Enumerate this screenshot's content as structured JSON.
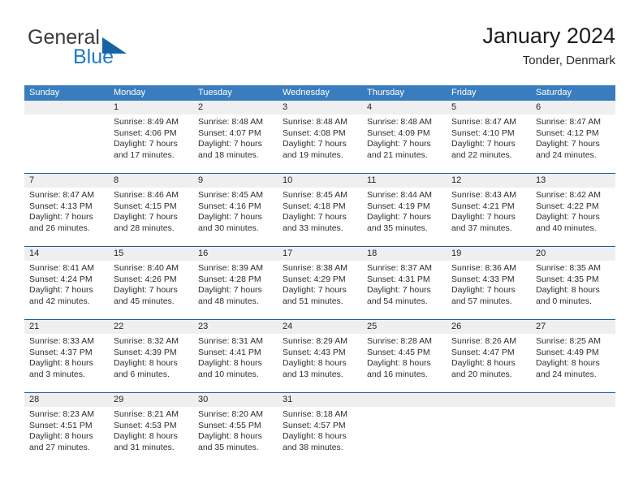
{
  "brand": {
    "word1": "General",
    "word2": "Blue",
    "triangle_color": "#1464a5"
  },
  "header": {
    "title": "January 2024",
    "subtitle": "Tonder, Denmark"
  },
  "theme": {
    "header_blue": "#3a7dbf",
    "separator_blue": "#1f5fa0",
    "daynum_band": "#efefef"
  },
  "weekday_headers": [
    "Sunday",
    "Monday",
    "Tuesday",
    "Wednesday",
    "Thursday",
    "Friday",
    "Saturday"
  ],
  "weeks": [
    [
      {
        "day": "",
        "lines": []
      },
      {
        "day": "1",
        "lines": [
          "Sunrise: 8:49 AM",
          "Sunset: 4:06 PM",
          "Daylight: 7 hours",
          "and 17 minutes."
        ]
      },
      {
        "day": "2",
        "lines": [
          "Sunrise: 8:48 AM",
          "Sunset: 4:07 PM",
          "Daylight: 7 hours",
          "and 18 minutes."
        ]
      },
      {
        "day": "3",
        "lines": [
          "Sunrise: 8:48 AM",
          "Sunset: 4:08 PM",
          "Daylight: 7 hours",
          "and 19 minutes."
        ]
      },
      {
        "day": "4",
        "lines": [
          "Sunrise: 8:48 AM",
          "Sunset: 4:09 PM",
          "Daylight: 7 hours",
          "and 21 minutes."
        ]
      },
      {
        "day": "5",
        "lines": [
          "Sunrise: 8:47 AM",
          "Sunset: 4:10 PM",
          "Daylight: 7 hours",
          "and 22 minutes."
        ]
      },
      {
        "day": "6",
        "lines": [
          "Sunrise: 8:47 AM",
          "Sunset: 4:12 PM",
          "Daylight: 7 hours",
          "and 24 minutes."
        ]
      }
    ],
    [
      {
        "day": "7",
        "lines": [
          "Sunrise: 8:47 AM",
          "Sunset: 4:13 PM",
          "Daylight: 7 hours",
          "and 26 minutes."
        ]
      },
      {
        "day": "8",
        "lines": [
          "Sunrise: 8:46 AM",
          "Sunset: 4:15 PM",
          "Daylight: 7 hours",
          "and 28 minutes."
        ]
      },
      {
        "day": "9",
        "lines": [
          "Sunrise: 8:45 AM",
          "Sunset: 4:16 PM",
          "Daylight: 7 hours",
          "and 30 minutes."
        ]
      },
      {
        "day": "10",
        "lines": [
          "Sunrise: 8:45 AM",
          "Sunset: 4:18 PM",
          "Daylight: 7 hours",
          "and 33 minutes."
        ]
      },
      {
        "day": "11",
        "lines": [
          "Sunrise: 8:44 AM",
          "Sunset: 4:19 PM",
          "Daylight: 7 hours",
          "and 35 minutes."
        ]
      },
      {
        "day": "12",
        "lines": [
          "Sunrise: 8:43 AM",
          "Sunset: 4:21 PM",
          "Daylight: 7 hours",
          "and 37 minutes."
        ]
      },
      {
        "day": "13",
        "lines": [
          "Sunrise: 8:42 AM",
          "Sunset: 4:22 PM",
          "Daylight: 7 hours",
          "and 40 minutes."
        ]
      }
    ],
    [
      {
        "day": "14",
        "lines": [
          "Sunrise: 8:41 AM",
          "Sunset: 4:24 PM",
          "Daylight: 7 hours",
          "and 42 minutes."
        ]
      },
      {
        "day": "15",
        "lines": [
          "Sunrise: 8:40 AM",
          "Sunset: 4:26 PM",
          "Daylight: 7 hours",
          "and 45 minutes."
        ]
      },
      {
        "day": "16",
        "lines": [
          "Sunrise: 8:39 AM",
          "Sunset: 4:28 PM",
          "Daylight: 7 hours",
          "and 48 minutes."
        ]
      },
      {
        "day": "17",
        "lines": [
          "Sunrise: 8:38 AM",
          "Sunset: 4:29 PM",
          "Daylight: 7 hours",
          "and 51 minutes."
        ]
      },
      {
        "day": "18",
        "lines": [
          "Sunrise: 8:37 AM",
          "Sunset: 4:31 PM",
          "Daylight: 7 hours",
          "and 54 minutes."
        ]
      },
      {
        "day": "19",
        "lines": [
          "Sunrise: 8:36 AM",
          "Sunset: 4:33 PM",
          "Daylight: 7 hours",
          "and 57 minutes."
        ]
      },
      {
        "day": "20",
        "lines": [
          "Sunrise: 8:35 AM",
          "Sunset: 4:35 PM",
          "Daylight: 8 hours",
          "and 0 minutes."
        ]
      }
    ],
    [
      {
        "day": "21",
        "lines": [
          "Sunrise: 8:33 AM",
          "Sunset: 4:37 PM",
          "Daylight: 8 hours",
          "and 3 minutes."
        ]
      },
      {
        "day": "22",
        "lines": [
          "Sunrise: 8:32 AM",
          "Sunset: 4:39 PM",
          "Daylight: 8 hours",
          "and 6 minutes."
        ]
      },
      {
        "day": "23",
        "lines": [
          "Sunrise: 8:31 AM",
          "Sunset: 4:41 PM",
          "Daylight: 8 hours",
          "and 10 minutes."
        ]
      },
      {
        "day": "24",
        "lines": [
          "Sunrise: 8:29 AM",
          "Sunset: 4:43 PM",
          "Daylight: 8 hours",
          "and 13 minutes."
        ]
      },
      {
        "day": "25",
        "lines": [
          "Sunrise: 8:28 AM",
          "Sunset: 4:45 PM",
          "Daylight: 8 hours",
          "and 16 minutes."
        ]
      },
      {
        "day": "26",
        "lines": [
          "Sunrise: 8:26 AM",
          "Sunset: 4:47 PM",
          "Daylight: 8 hours",
          "and 20 minutes."
        ]
      },
      {
        "day": "27",
        "lines": [
          "Sunrise: 8:25 AM",
          "Sunset: 4:49 PM",
          "Daylight: 8 hours",
          "and 24 minutes."
        ]
      }
    ],
    [
      {
        "day": "28",
        "lines": [
          "Sunrise: 8:23 AM",
          "Sunset: 4:51 PM",
          "Daylight: 8 hours",
          "and 27 minutes."
        ]
      },
      {
        "day": "29",
        "lines": [
          "Sunrise: 8:21 AM",
          "Sunset: 4:53 PM",
          "Daylight: 8 hours",
          "and 31 minutes."
        ]
      },
      {
        "day": "30",
        "lines": [
          "Sunrise: 8:20 AM",
          "Sunset: 4:55 PM",
          "Daylight: 8 hours",
          "and 35 minutes."
        ]
      },
      {
        "day": "31",
        "lines": [
          "Sunrise: 8:18 AM",
          "Sunset: 4:57 PM",
          "Daylight: 8 hours",
          "and 38 minutes."
        ]
      },
      {
        "day": "",
        "lines": []
      },
      {
        "day": "",
        "lines": []
      },
      {
        "day": "",
        "lines": []
      }
    ]
  ]
}
